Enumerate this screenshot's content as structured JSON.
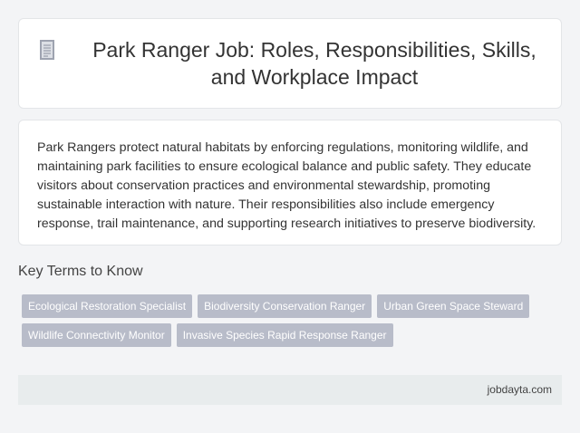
{
  "header": {
    "icon": "document-icon",
    "title": "Park Ranger Job: Roles, Responsibilities, Skills, and Workplace Impact"
  },
  "summary": {
    "text": "Park Rangers protect natural habitats by enforcing regulations, monitoring wildlife, and maintaining park facilities to ensure ecological balance and public safety. They educate visitors about conservation practices and environmental stewardship, promoting sustainable interaction with nature. Their responsibilities also include emergency response, trail maintenance, and supporting research initiatives to preserve biodiversity."
  },
  "key_terms": {
    "heading": "Key Terms to Know",
    "items": [
      "Ecological Restoration Specialist",
      "Biodiversity Conservation Ranger",
      "Urban Green Space Steward",
      "Wildlife Connectivity Monitor",
      "Invasive Species Rapid Response Ranger"
    ]
  },
  "footer": {
    "site": "jobdayta.com"
  },
  "colors": {
    "background": "#f3f4f6",
    "chip": "#b8bcc9",
    "footer": "#e8eced"
  }
}
